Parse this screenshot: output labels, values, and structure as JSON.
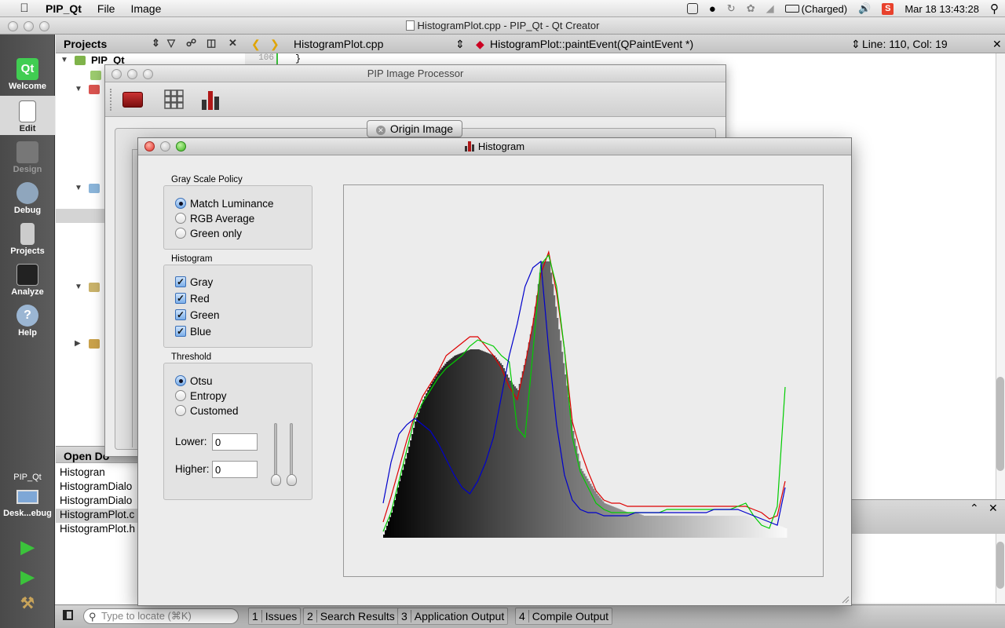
{
  "menubar": {
    "app": "PIP_Qt",
    "menus": [
      "File",
      "Image"
    ],
    "battery": "(Charged)",
    "clock": "Mar 18  13:43:28",
    "s_badge": "S"
  },
  "qt": {
    "window_title": "HistogramPlot.cpp - PIP_Qt - Qt Creator",
    "modes": {
      "logo": "Qt",
      "welcome": "Welcome",
      "edit": "Edit",
      "design": "Design",
      "debug": "Debug",
      "projects": "Projects",
      "analyze": "Analyze",
      "help": "Help",
      "help_glyph": "?"
    },
    "kit": {
      "project": "PIP_Qt",
      "target": "Desk...ebug"
    },
    "projects_header": "Projects",
    "tree_root": "PIP_Qt",
    "open_docs_header": "Open Do",
    "open_docs": [
      "Histogran",
      "HistogramDialo",
      "HistogramDialo",
      "HistogramPlot.c",
      "HistogramPlot.h"
    ],
    "editor": {
      "file": "HistogramPlot.cpp",
      "symbol": "HistogramPlot::paintEvent(QPaintEvent *)",
      "position": "Line: 110, Col: 19",
      "line_no": "106",
      "line_text": "}"
    },
    "locate_placeholder": "Type to locate (⌘K)",
    "output_tabs": [
      {
        "n": "1",
        "label": "Issues"
      },
      {
        "n": "2",
        "label": "Search Results"
      },
      {
        "n": "3",
        "label": "Application Output"
      },
      {
        "n": "4",
        "label": "Compile Output"
      }
    ]
  },
  "pip": {
    "title": "PIP Image Processor",
    "tab": "Origin Image"
  },
  "histogram_window": {
    "title": "Histogram",
    "gray_policy": {
      "title": "Gray Scale Policy",
      "options": [
        "Match Luminance",
        "RGB Average",
        "Green only"
      ],
      "selected": 0
    },
    "histogram_group": {
      "title": "Histogram",
      "checks": [
        "Gray",
        "Red",
        "Green",
        "Blue"
      ],
      "checked": [
        true,
        true,
        true,
        true
      ]
    },
    "threshold": {
      "title": "Threshold",
      "options": [
        "Otsu",
        "Entropy",
        "Customed"
      ],
      "selected": 0,
      "lower_label": "Lower:",
      "lower_value": "0",
      "higher_label": "Higher:",
      "higher_value": "0"
    }
  },
  "chart_data": {
    "type": "area",
    "x": [
      0,
      5,
      10,
      15,
      20,
      25,
      30,
      35,
      40,
      45,
      50,
      55,
      60,
      65,
      70,
      75,
      80,
      85,
      90,
      95,
      100,
      105,
      110,
      115,
      120,
      125,
      130,
      135,
      140,
      145,
      150,
      155,
      160,
      165,
      170,
      175,
      180,
      185,
      190,
      195,
      200,
      205,
      210,
      215,
      220,
      225,
      230,
      235,
      240,
      245,
      250,
      255
    ],
    "xlim": [
      0,
      255
    ],
    "ylim": [
      0,
      100
    ],
    "series": [
      {
        "name": "Gray",
        "color": "#333333",
        "values": [
          1,
          8,
          18,
          27,
          37,
          44,
          49,
          53,
          56,
          58,
          59,
          60,
          60,
          59,
          58,
          55,
          50,
          47,
          57,
          70,
          88,
          88,
          70,
          52,
          34,
          22,
          18,
          14,
          11,
          10,
          9,
          8,
          8,
          7,
          7,
          7,
          7,
          7,
          7,
          7,
          7,
          7,
          7,
          7,
          7,
          7,
          7,
          6,
          6,
          5,
          4,
          3
        ]
      },
      {
        "name": "Red",
        "color": "#dd0000",
        "values": [
          5,
          13,
          22,
          31,
          39,
          45,
          49,
          53,
          58,
          60,
          62,
          64,
          64,
          61,
          58,
          54,
          48,
          44,
          55,
          68,
          84,
          91,
          78,
          60,
          37,
          28,
          21,
          15,
          12,
          11,
          11,
          10,
          10,
          10,
          10,
          10,
          10,
          10,
          10,
          10,
          10,
          10,
          10,
          10,
          10,
          10,
          10,
          9,
          8,
          6,
          7,
          18
        ]
      },
      {
        "name": "Green",
        "color": "#00cc00",
        "values": [
          2,
          8,
          18,
          28,
          38,
          43,
          47,
          51,
          54,
          56,
          58,
          61,
          63,
          62,
          61,
          58,
          56,
          35,
          32,
          59,
          87,
          90,
          80,
          60,
          32,
          21,
          16,
          11,
          9,
          8,
          8,
          8,
          8,
          8,
          8,
          8,
          9,
          9,
          9,
          9,
          9,
          9,
          9,
          9,
          9,
          10,
          11,
          7,
          4,
          3,
          10,
          48
        ]
      },
      {
        "name": "Blue",
        "color": "#0000cc",
        "values": [
          11,
          24,
          33,
          36,
          38,
          36,
          34,
          30,
          25,
          20,
          16,
          14,
          18,
          24,
          32,
          45,
          58,
          68,
          80,
          86,
          88,
          60,
          36,
          20,
          12,
          9,
          8,
          8,
          7,
          7,
          7,
          7,
          8,
          8,
          8,
          8,
          8,
          8,
          8,
          8,
          8,
          8,
          9,
          9,
          9,
          9,
          8,
          7,
          6,
          5,
          4,
          16
        ]
      }
    ]
  }
}
